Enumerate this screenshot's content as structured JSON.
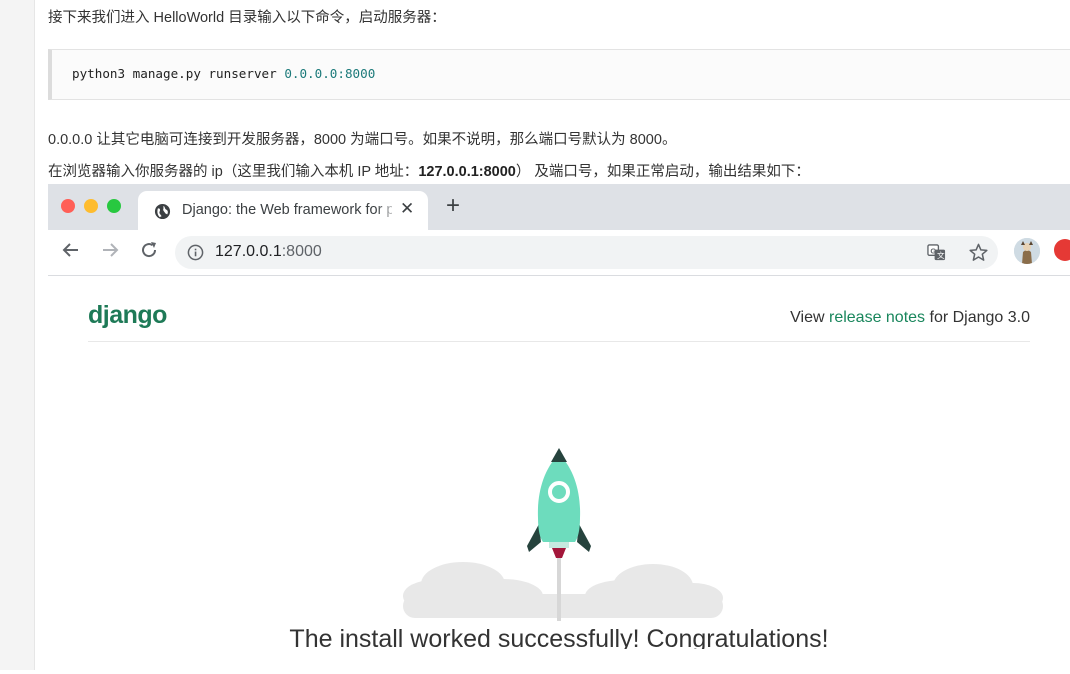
{
  "article": {
    "line1": "接下来我们进入 HelloWorld 目录输入以下命令，启动服务器：",
    "code_cmd": "python3 manage.py runserver ",
    "code_addr": "0.0.0.0:8000",
    "line2": "0.0.0.0 让其它电脑可连接到开发服务器，8000 为端口号。如果不说明，那么端口号默认为 8000。",
    "line3_pre": "在浏览器输入你服务器的 ip（这里我们输入本机 IP 地址：",
    "line3_bold": "127.0.0.1:8000",
    "line3_post": "） 及端口号，如果正常启动，输出结果如下："
  },
  "browser": {
    "tab_title": "Django: the Web framework for perfectionists",
    "url_host": "127.0.0.1",
    "url_port": ":8000"
  },
  "django": {
    "logo": "django",
    "notes_pre": "View ",
    "notes_link": "release notes",
    "notes_post": " for Django 3.0",
    "headline": "The install worked successfully! Congratulations!"
  },
  "colors": {
    "accent_green": "#19865c",
    "rocket_body": "#6ddcbd",
    "traffic_red": "#ff5f57",
    "traffic_yellow": "#febc2e",
    "traffic_green": "#28c840"
  }
}
